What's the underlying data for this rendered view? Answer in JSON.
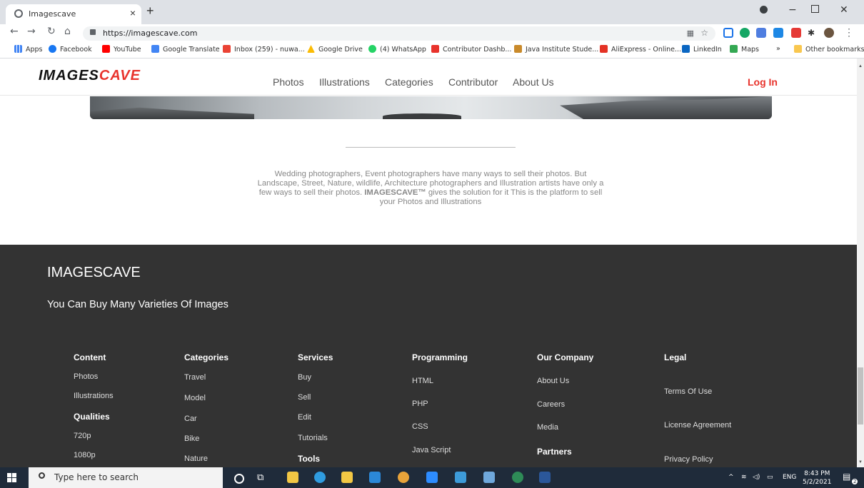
{
  "browser": {
    "tab_title": "Imagescave",
    "url": "https://imagescave.com",
    "bookmarks": [
      "Apps",
      "Facebook",
      "YouTube",
      "Google Translate",
      "Inbox (259) - nuwa...",
      "Google Drive",
      "(4) WhatsApp",
      "Contributor Dashb...",
      "Java Institute Stude...",
      "AliExpress - Online...",
      "LinkedIn",
      "Maps"
    ],
    "bookmarks_more": "»",
    "other_bookmarks": "Other bookmarks"
  },
  "site": {
    "logo_part1": "IMAGES",
    "logo_part2": "CAVE",
    "nav": [
      "Photos",
      "Illustrations",
      "Categories",
      "Contributor",
      "About Us"
    ],
    "login": "Log In",
    "description_part1": "Wedding photographers, Event photographers have many ways to sell their photos. But Landscape, Street, Nature, wildlife, Architecture photographers and Illustration artists have only a few ways to sell their photos. ",
    "description_brand": "IMAGESCAVE™",
    "description_part2": " gives the solution for it This is the platform to sell your Photos and Illustrations"
  },
  "footer": {
    "brand": "IMAGESCAVE",
    "tagline": "You Can Buy Many Varieties Of Images",
    "content_heading": "Content",
    "content_items": [
      "Photos",
      "Illustrations"
    ],
    "qualities_heading": "Qualities",
    "qualities_items": [
      "720p",
      "1080p"
    ],
    "categories_heading": "Categories",
    "categories_items": [
      "Travel",
      "Model",
      "Car",
      "Bike",
      "Nature"
    ],
    "services_heading": "Services",
    "services_items": [
      "Buy",
      "Sell",
      "Edit",
      "Tutorials"
    ],
    "tools_heading": "Tools",
    "programming_heading": "Programming",
    "programming_items": [
      "HTML",
      "PHP",
      "CSS",
      "Java Script"
    ],
    "company_heading": "Our Company",
    "company_items": [
      "About Us",
      "Careers",
      "Media"
    ],
    "partners_heading": "Partners",
    "legal_heading": "Legal",
    "legal_items": [
      "Terms Of Use",
      "License Agreement",
      "Privacy Policy"
    ]
  },
  "taskbar": {
    "search_placeholder": "Type here to search",
    "lang": "ENG",
    "time": "8:43 PM",
    "date": "5/2/2021",
    "notifications": "2"
  },
  "colors": {
    "accent": "#e8332c",
    "footer_bg": "#333333",
    "taskbar_bg": "#1f2b3a"
  }
}
